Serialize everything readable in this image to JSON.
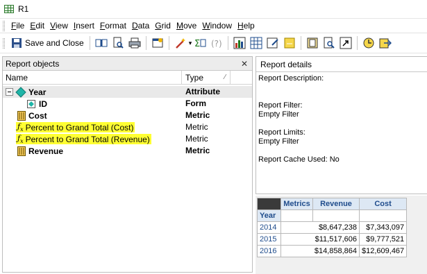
{
  "window": {
    "title": "R1"
  },
  "menu": {
    "items": [
      {
        "label": "File",
        "accel": "F",
        "rest": "ile"
      },
      {
        "label": "Edit",
        "accel": "E",
        "rest": "dit"
      },
      {
        "label": "View",
        "accel": "V",
        "rest": "iew"
      },
      {
        "label": "Insert",
        "accel": "I",
        "rest": "nsert"
      },
      {
        "label": "Format",
        "accel": "F",
        "rest": "ormat"
      },
      {
        "label": "Data",
        "accel": "D",
        "rest": "ata"
      },
      {
        "label": "Grid",
        "accel": "G",
        "rest": "rid"
      },
      {
        "label": "Move",
        "accel": "M",
        "rest": "ove"
      },
      {
        "label": "Window",
        "accel": "W",
        "rest": "indow"
      },
      {
        "label": "Help",
        "accel": "H",
        "rest": "elp"
      }
    ]
  },
  "toolbar": {
    "save_close_label": "Save and Close"
  },
  "report_objects": {
    "title": "Report objects",
    "col_name": "Name",
    "col_type": "Type",
    "rows": [
      {
        "name": "Year",
        "type": "Attribute",
        "bold": true
      },
      {
        "name": "ID",
        "type": "Form",
        "bold": true
      },
      {
        "name": "Cost",
        "type": "Metric",
        "bold": true
      },
      {
        "name": "Percent to Grand Total (Cost)",
        "type": "Metric",
        "bold": false
      },
      {
        "name": "Percent to Grand Total (Revenue)",
        "type": "Metric",
        "bold": false
      },
      {
        "name": "Revenue",
        "type": "Metric",
        "bold": true
      }
    ]
  },
  "report_details": {
    "title": "Report details",
    "description_label": "Report Description:",
    "filter_label": "Report Filter:",
    "filter_value": "Empty Filter",
    "limits_label": "Report Limits:",
    "limits_value": "Empty Filter",
    "cache_label": "Report Cache Used: No"
  },
  "grid": {
    "metrics_header": "Metrics",
    "columns": [
      "Revenue",
      "Cost"
    ],
    "row_header": "Year",
    "rows": [
      {
        "year": "2014",
        "revenue": "$8,647,238",
        "cost": "$7,343,097"
      },
      {
        "year": "2015",
        "revenue": "$11,517,606",
        "cost": "$9,777,521"
      },
      {
        "year": "2016",
        "revenue": "$14,858,864",
        "cost": "$12,609,467"
      }
    ]
  }
}
